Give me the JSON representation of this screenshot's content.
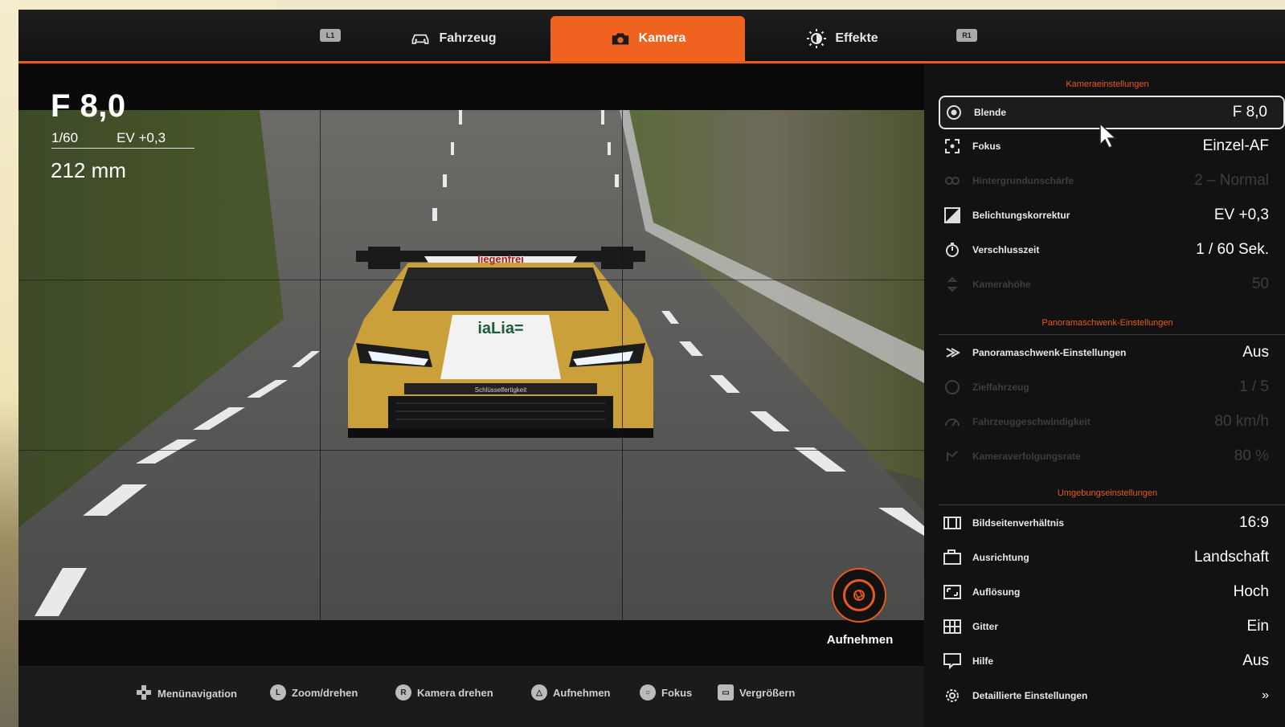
{
  "tabs": {
    "left_shoulder": "L1",
    "right_shoulder": "R1",
    "items": [
      {
        "label": "Fahrzeug",
        "icon": "car-icon",
        "active": false
      },
      {
        "label": "Kamera",
        "icon": "camera-icon",
        "active": true
      },
      {
        "label": "Effekte",
        "icon": "brightness-icon",
        "active": false
      }
    ]
  },
  "hud": {
    "aperture": "F 8,0",
    "shutter": "1/60",
    "ev": "EV +0,3",
    "focal_length": "212 mm"
  },
  "car_livery_text": [
    "liegenfrei",
    "iaLia=",
    "Schlüsselfertigkeit"
  ],
  "capture": {
    "label": "Aufnehmen",
    "icon": "shutter-icon"
  },
  "panel": {
    "camera_section": "Kameraeinstellungen",
    "camera_rows": [
      {
        "icon": "aperture-icon",
        "label": "Blende",
        "value": "F 8,0",
        "selected": true,
        "enabled": true
      },
      {
        "icon": "focus-icon",
        "label": "Fokus",
        "value": "Einzel-AF",
        "selected": false,
        "enabled": true
      },
      {
        "icon": "bokeh-icon",
        "label": "Hintergrundunschärfe",
        "value": "2 – Normal",
        "selected": false,
        "enabled": false
      },
      {
        "icon": "exposure-icon",
        "label": "Belichtungskorrektur",
        "value": "EV +0,3",
        "selected": false,
        "enabled": true
      },
      {
        "icon": "timer-icon",
        "label": "Verschlusszeit",
        "value": "1 / 60 Sek.",
        "selected": false,
        "enabled": true
      },
      {
        "icon": "camera-height-icon",
        "label": "Kamerahöhe",
        "value": "50",
        "selected": false,
        "enabled": false
      }
    ],
    "pan_section": "Panoramaschwenk-Einstellungen",
    "pan_rows": [
      {
        "icon": "pan-icon",
        "label": "Panoramaschwenk-Einstellungen",
        "value": "Aus",
        "enabled": true
      },
      {
        "icon": "target-icon",
        "label": "Zielfahrzeug",
        "value": "1 / 5",
        "enabled": false
      },
      {
        "icon": "speed-icon",
        "label": "Fahrzeuggeschwindigkeit",
        "value": "80 km/h",
        "enabled": false
      },
      {
        "icon": "track-icon",
        "label": "Kameraverfolgungsrate",
        "value": "80 %",
        "enabled": false
      }
    ],
    "env_section": "Umgebungseinstellungen",
    "env_rows": [
      {
        "icon": "aspect-ratio-icon",
        "label": "Bildseitenverhältnis",
        "value": "16:9"
      },
      {
        "icon": "orientation-icon",
        "label": "Ausrichtung",
        "value": "Landschaft"
      },
      {
        "icon": "resolution-icon",
        "label": "Auflösung",
        "value": "Hoch"
      },
      {
        "icon": "grid-icon",
        "label": "Gitter",
        "value": "Ein"
      },
      {
        "icon": "help-icon",
        "label": "Hilfe",
        "value": "Aus"
      }
    ],
    "detail": {
      "icon": "gear-icon",
      "label": "Detaillierte Einstellungen",
      "value": "»"
    }
  },
  "hints": [
    {
      "icon": "dpad-icon",
      "label": "Menünavigation"
    },
    {
      "icon": "left-stick-icon",
      "glyph": "L",
      "label": "Zoom/drehen"
    },
    {
      "icon": "right-stick-icon",
      "glyph": "R",
      "label": "Kamera drehen"
    },
    {
      "icon": "triangle-icon",
      "glyph": "△",
      "label": "Aufnehmen"
    },
    {
      "icon": "circle-icon",
      "glyph": "○",
      "label": "Fokus"
    },
    {
      "icon": "touchpad-icon",
      "glyph": "▭",
      "label": "Vergrößern"
    }
  ],
  "colors": {
    "accent": "#f0621f",
    "panel_bg": "#121212",
    "text": "#ffffff"
  }
}
